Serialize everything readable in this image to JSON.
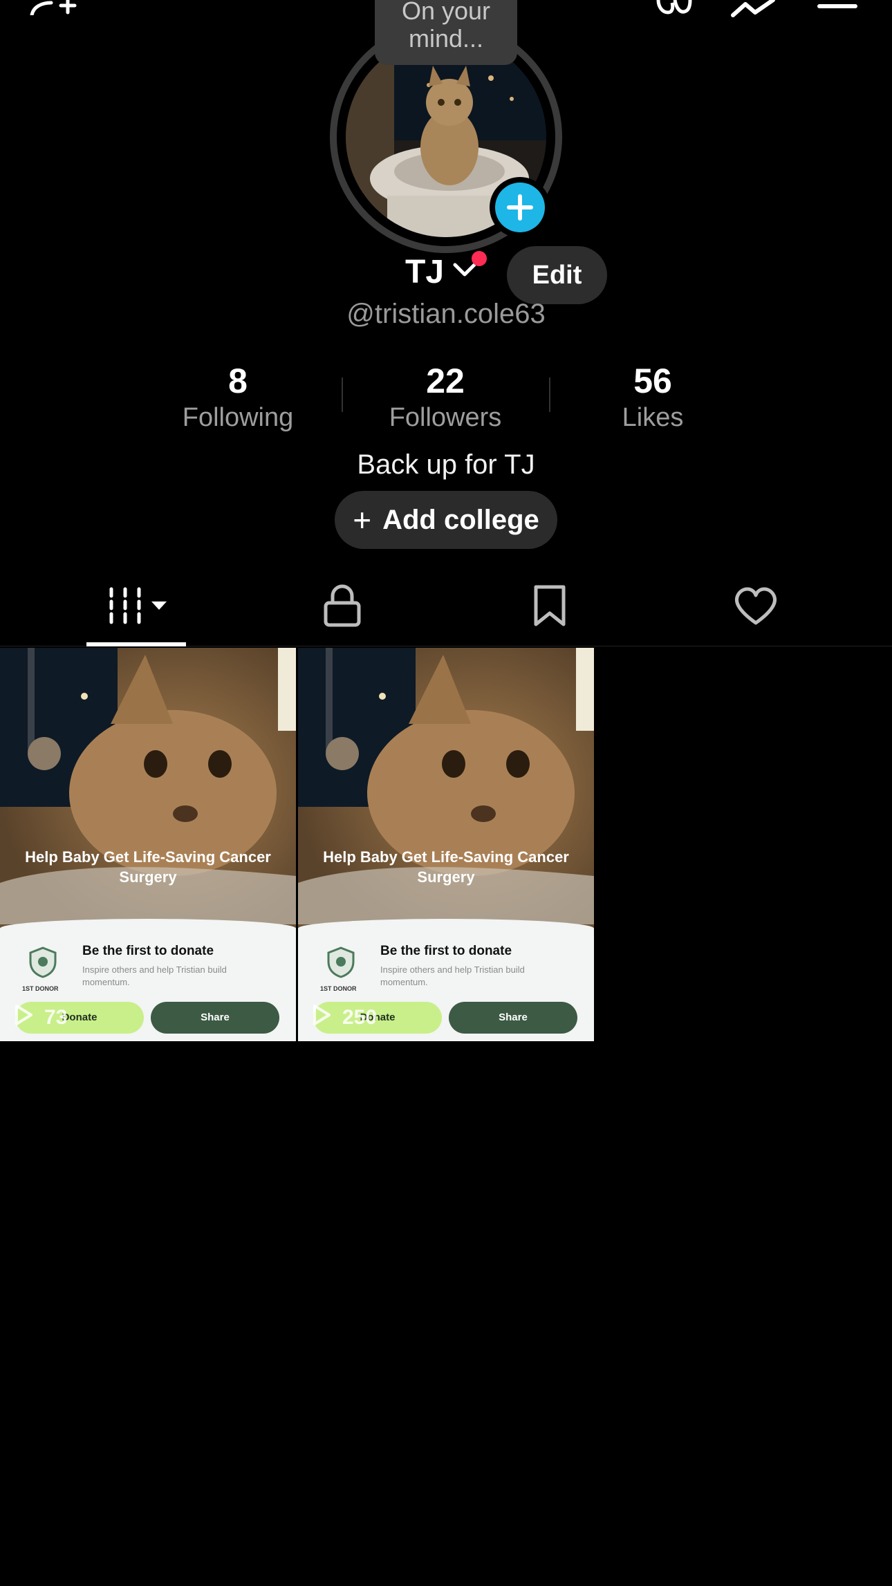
{
  "header": {
    "icons": [
      "add-friend-icon",
      "footprint-icon",
      "activity-icon",
      "menu-icon"
    ]
  },
  "profile": {
    "mind_bubble": "On your mind...",
    "name": "TJ",
    "edit_label": "Edit",
    "handle": "@tristian.cole63",
    "bio": "Back up for TJ",
    "add_college_label": "Add college",
    "notification_color": "#fe2c55",
    "story_add_color": "#1db6e7"
  },
  "stats": [
    {
      "value": "8",
      "label": "Following"
    },
    {
      "value": "22",
      "label": "Followers"
    },
    {
      "value": "56",
      "label": "Likes"
    }
  ],
  "tabs": [
    {
      "name": "videos",
      "icon": "grid-icon",
      "selected": true
    },
    {
      "name": "private",
      "icon": "lock-icon",
      "selected": false
    },
    {
      "name": "favorites",
      "icon": "bookmark-icon",
      "selected": false
    },
    {
      "name": "liked",
      "icon": "heart-icon",
      "selected": false
    }
  ],
  "videos": [
    {
      "headline": "Help Baby Get Life-Saving Cancer Surgery",
      "card_title": "Be the first to donate",
      "card_subtitle": "Inspire others and help Tristian build momentum.",
      "badge_label": "1ST DONOR",
      "donate_label": "Donate",
      "share_label": "Share",
      "views": "73"
    },
    {
      "headline": "Help Baby Get Life-Saving Cancer Surgery",
      "card_title": "Be the first to donate",
      "card_subtitle": "Inspire others and help Tristian build momentum.",
      "badge_label": "1ST DONOR",
      "donate_label": "Donate",
      "share_label": "Share",
      "views": "250"
    }
  ]
}
